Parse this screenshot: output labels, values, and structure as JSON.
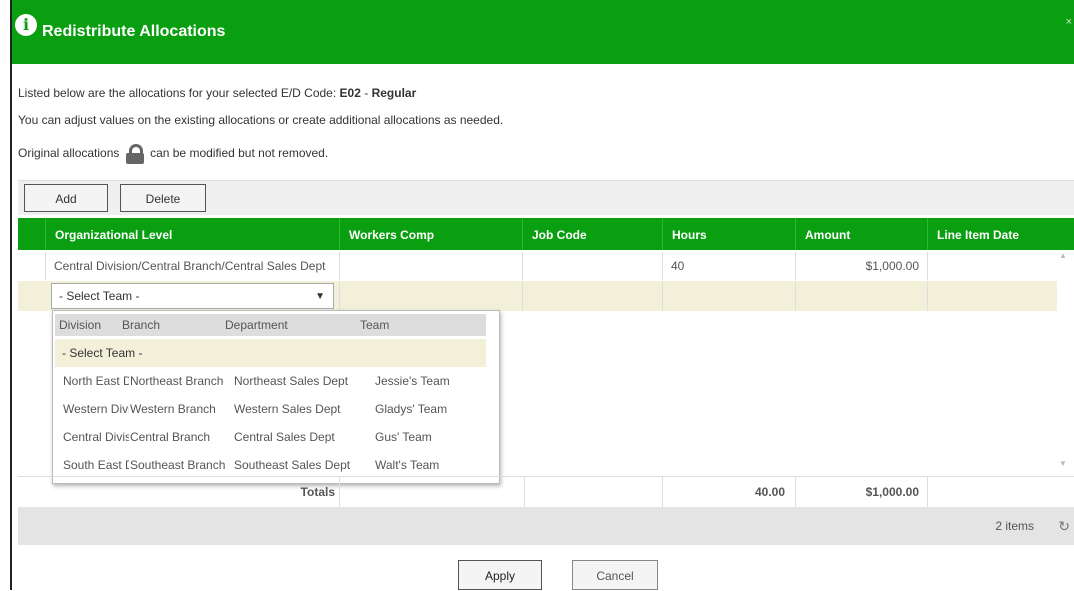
{
  "dialog": {
    "title": "Redistribute Allocations",
    "close_label": "×"
  },
  "messages": {
    "line1_prefix": "Listed below are the allocations for your selected E/D Code:",
    "code": "E02",
    "separator": "-",
    "code_name": "Regular",
    "line2": "You can adjust values on the existing allocations or create additional allocations as needed.",
    "line3_prefix": "Original allocations",
    "line3_suffix": "can be modified but not removed."
  },
  "toolbar": {
    "add_label": "Add",
    "delete_label": "Delete"
  },
  "grid": {
    "columns": [
      "Organizational Level",
      "Workers Comp",
      "Job Code",
      "Hours",
      "Amount",
      "Line Item Date"
    ],
    "rows": [
      {
        "org_level": "Central Division/Central Branch/Central Sales Dept",
        "workers_comp": "",
        "job_code": "",
        "hours": "40",
        "amount": "$1,000.00",
        "line_item_date": ""
      }
    ],
    "new_row_select": "- Select Team -"
  },
  "team_dropdown": {
    "headers": [
      "Division",
      "Branch",
      "Department",
      "Team"
    ],
    "placeholder": "- Select Team -",
    "options": [
      {
        "division": "North East Division",
        "branch": "Northeast Branch",
        "department": "Northeast Sales Dept",
        "team": "Jessie's Team"
      },
      {
        "division": "Western Division",
        "branch": "Western Branch",
        "department": "Western Sales Dept",
        "team": "Gladys' Team"
      },
      {
        "division": "Central Division",
        "branch": "Central Branch",
        "department": "Central Sales Dept",
        "team": "Gus' Team"
      },
      {
        "division": "South East Division",
        "branch": "Southeast Branch",
        "department": "Southeast Sales Dept",
        "team": "Walt's Team"
      }
    ]
  },
  "totals": {
    "label": "Totals",
    "hours": "40.00",
    "amount": "$1,000.00"
  },
  "footer": {
    "item_count": "2 items"
  },
  "actions": {
    "apply_label": "Apply",
    "cancel_label": "Cancel"
  },
  "colors": {
    "header_green": "#0a9e11",
    "highlight": "#f3f0da"
  }
}
